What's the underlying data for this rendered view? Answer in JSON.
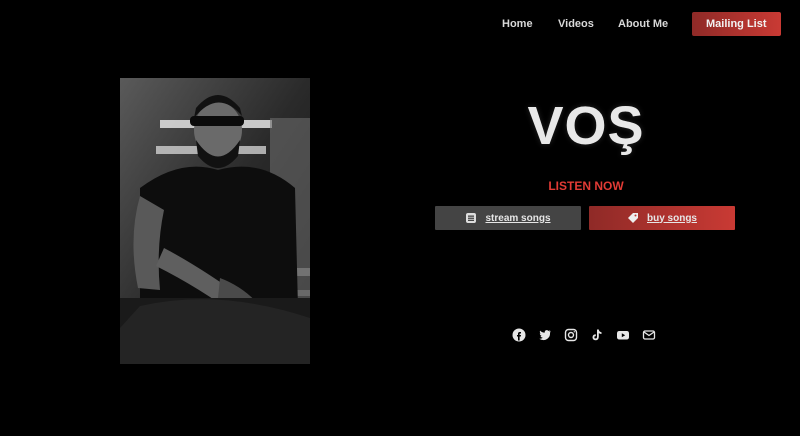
{
  "nav": {
    "home": "Home",
    "videos": "Videos",
    "about": "About Me",
    "mailing": "Mailing List"
  },
  "brand": {
    "name": "VOŞ"
  },
  "listen": {
    "label": "LISTEN NOW"
  },
  "buttons": {
    "stream": {
      "label": "stream songs",
      "icon": "stream-icon"
    },
    "buy": {
      "label": "buy songs",
      "icon": "tag-icon"
    }
  },
  "social": {
    "icons": [
      "facebook-icon",
      "twitter-icon",
      "instagram-icon",
      "tiktok-icon",
      "youtube-icon",
      "email-icon"
    ]
  },
  "colors": {
    "accent": "#c93a34",
    "listen": "#e23b35",
    "bg": "#000000",
    "stream_bg": "#444444"
  }
}
